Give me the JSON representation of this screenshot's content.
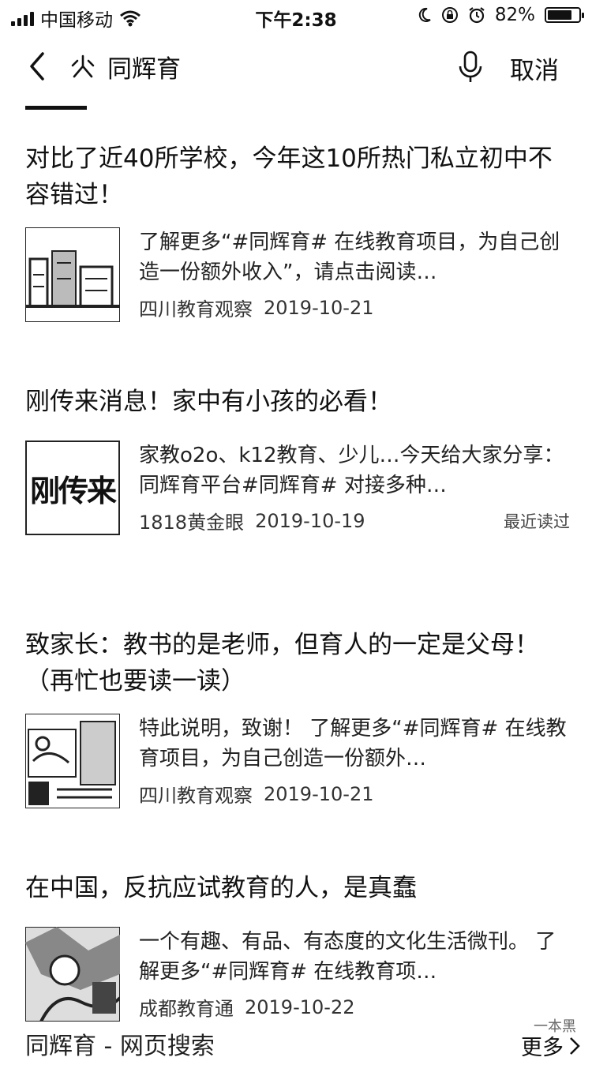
{
  "status_bar": {
    "carrier": "中国移动",
    "time": "下午2:38",
    "battery_text": "82%",
    "battery_level": 0.82,
    "icons": [
      "signal-icon",
      "wifi-icon",
      "moon-icon",
      "lock-rotation-icon",
      "alarm-icon",
      "battery-icon"
    ]
  },
  "search": {
    "query": "同辉育",
    "cancel_label": "取消",
    "icons": {
      "back": "chevron-left-icon",
      "search": "search-glyph-icon",
      "mic": "microphone-icon"
    }
  },
  "results": [
    {
      "title": "对比了近40所学校，今年这10所热门私立初中不容错过！",
      "snippet": "了解更多“#同辉育# 在线教育项目，为自己创造一份额外收入”，请点击阅读…",
      "source": "四川教育观察",
      "date": "2019-10-21",
      "badge": ""
    },
    {
      "title": "刚传来消息！家中有小孩的必看！",
      "snippet": "家教o2o、k12教育、少儿…今天给大家分享：同辉育平台#同辉育# 对接多种…",
      "source": "1818黄金眼",
      "date": "2019-10-19",
      "badge": "最近读过",
      "thumb_text": "刚传来"
    },
    {
      "title": "致家长：教书的是老师，但育人的一定是父母！（再忙也要读一读）",
      "snippet": "特此说明，致谢！ 了解更多“#同辉育# 在线教育项目，为自己创造一份额外…",
      "source": "四川教育观察",
      "date": "2019-10-21",
      "badge": ""
    },
    {
      "title": "在中国，反抗应试教育的人，是真蠢",
      "snippet": "一个有趣、有品、有态度的文化生活微刊。 了解更多“#同辉育# 在线教育项…",
      "source": "成都教育通",
      "date": "2019-10-22",
      "badge": ""
    }
  ],
  "footer": {
    "web_search_label": "同辉育 - 网页搜索",
    "more_label": "更多",
    "watermark": "一本黑"
  }
}
